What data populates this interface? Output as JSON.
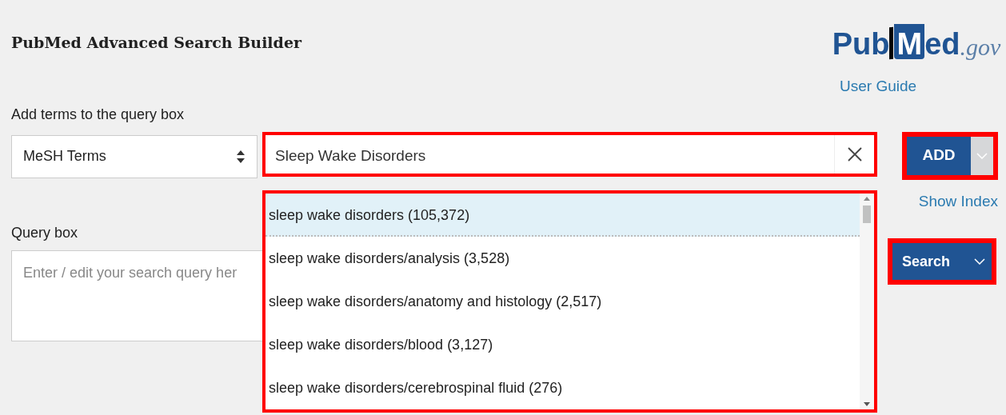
{
  "title": "PubMed Advanced Search Builder",
  "logo": {
    "part_1": "Pub",
    "badge": "M",
    "part_2": "ed",
    "suffix": ".gov"
  },
  "user_guide": "User Guide",
  "add_terms": {
    "label": "Add terms to the query box",
    "field_select": "MeSH Terms",
    "term": "Sleep Wake Disorders",
    "add_button": "ADD",
    "show_index": "Show Index"
  },
  "suggestions": [
    {
      "text": "sleep wake disorders (105,372)",
      "selected": true
    },
    {
      "text": "sleep wake disorders/analysis (3,528)",
      "selected": false
    },
    {
      "text": "sleep wake disorders/anatomy and histology (2,517)",
      "selected": false
    },
    {
      "text": "sleep wake disorders/blood (3,127)",
      "selected": false
    },
    {
      "text": "sleep wake disorders/cerebrospinal fluid (276)",
      "selected": false
    }
  ],
  "query_box": {
    "label": "Query box",
    "placeholder": "Enter / edit your search query her",
    "search_button": "Search"
  }
}
